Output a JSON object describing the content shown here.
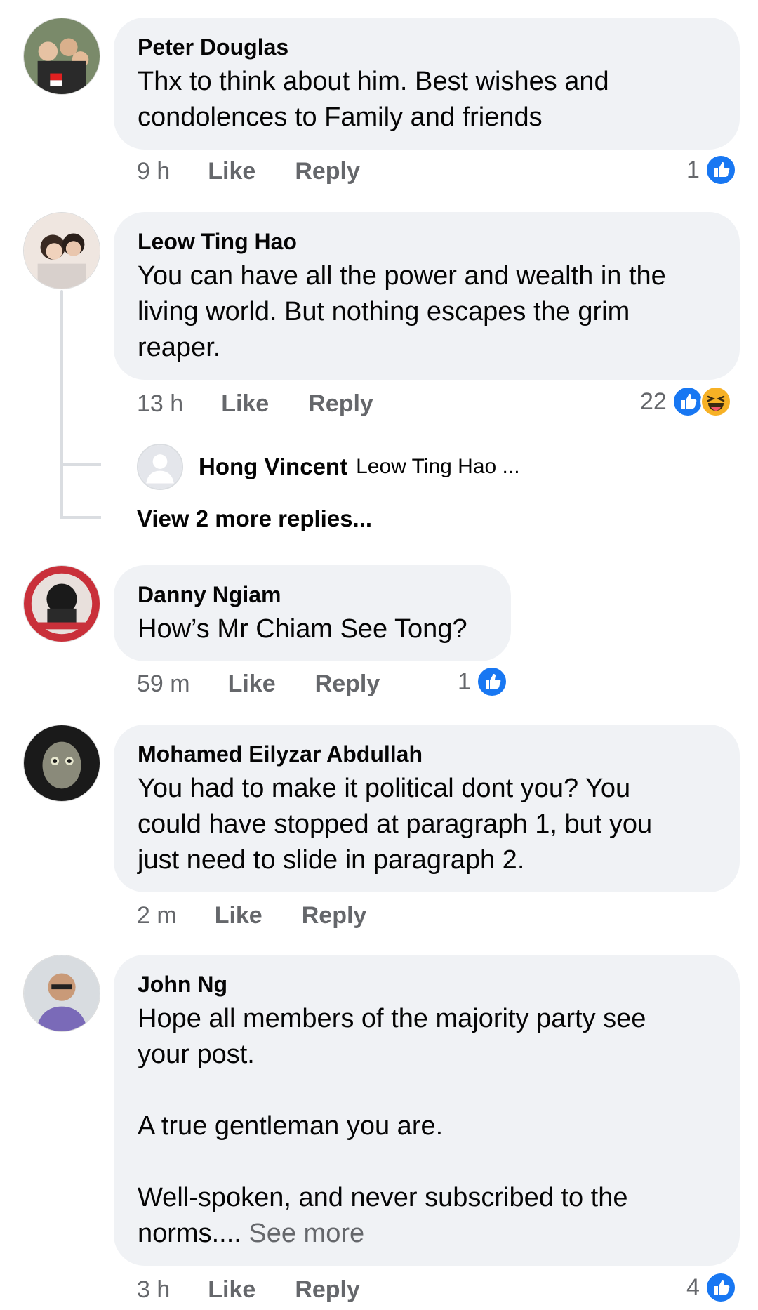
{
  "comments": [
    {
      "author": "Peter Douglas",
      "text": "Thx to think about him. Best wishes and\ncondolences to Family and friends",
      "time": "9 h",
      "like": "Like",
      "reply": "Reply",
      "reaction_count": "1",
      "reactions": [
        "like-icon"
      ]
    },
    {
      "author": "Leow Ting Hao",
      "text": "You can have all the power and wealth in the\nliving world. But nothing escapes the grim\nreaper.",
      "time": "13 h",
      "like": "Like",
      "reply": "Reply",
      "reaction_count": "22",
      "reactions": [
        "like-icon",
        "haha-icon"
      ],
      "replies_preview": {
        "author": "Hong Vincent",
        "snippet": "Leow Ting Hao ...",
        "view_more": "View 2 more replies..."
      }
    },
    {
      "author": "Danny Ngiam",
      "text": "How’s Mr Chiam See Tong?",
      "time": "59 m",
      "like": "Like",
      "reply": "Reply",
      "reaction_count": "1",
      "reactions": [
        "like-icon"
      ]
    },
    {
      "author": "Mohamed Eilyzar Abdullah",
      "text": "You had to make it political dont you? You\ncould have stopped at paragraph 1, but you\njust need to slide in paragraph 2.",
      "time": "2 m",
      "like": "Like",
      "reply": "Reply"
    },
    {
      "author": "John Ng",
      "text": "Hope all members of the majority party see\nyour post.\n\nA true gentleman you are.\n\nWell-spoken, and never subscribed to the\nnorms.... ",
      "see_more": "See more",
      "time": "3 h",
      "like": "Like",
      "reply": "Reply",
      "reaction_count": "4",
      "reactions": [
        "like-icon"
      ]
    }
  ],
  "colors": {
    "bubble": "#f0f2f5",
    "meta": "#65676b",
    "like_blue": "#1877f2",
    "haha_yellow": "#f7b125"
  }
}
